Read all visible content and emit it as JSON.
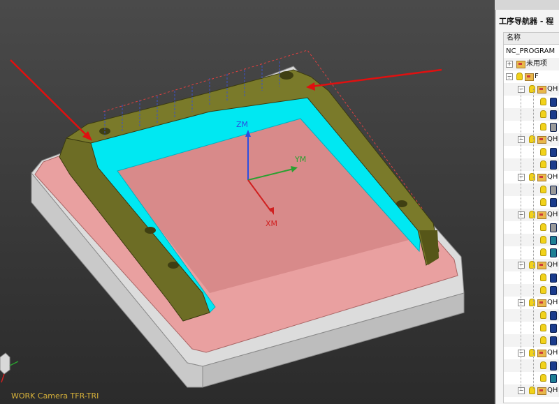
{
  "viewport": {
    "camera_label": "WORK Camera TFR-TRI",
    "axes": {
      "z": "ZM",
      "y": "YM",
      "x": "XM"
    },
    "colors": {
      "base": "#d9d9d9",
      "plate": "#e49a9a",
      "part": "#6a6a20",
      "toolpath": "#00e6f0"
    }
  },
  "navigator": {
    "title": "工序导航器 - 程",
    "column_header": "名称",
    "root": "NC_PROGRAM",
    "unused": "未用项",
    "folder": "F",
    "group_label": "QH"
  }
}
